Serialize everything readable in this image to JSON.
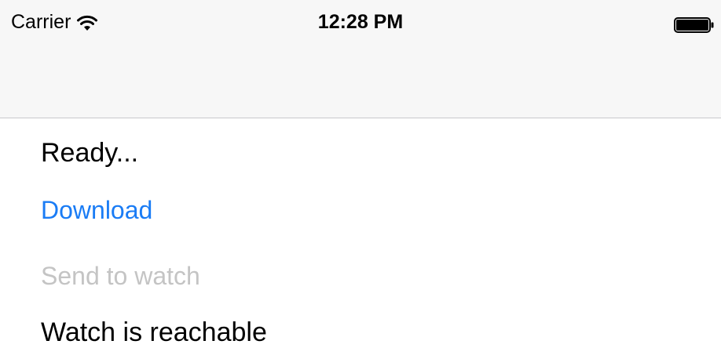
{
  "status_bar": {
    "carrier": "Carrier",
    "time": "12:28 PM",
    "wifi_icon": "wifi-icon",
    "battery_icon": "battery-icon"
  },
  "main": {
    "status_text": "Ready...",
    "download_label": "Download",
    "send_label": "Send to watch",
    "reachability_text": "Watch is reachable"
  },
  "colors": {
    "link_blue": "#1a7cf5",
    "disabled_gray": "#c4c4c4",
    "nav_bar_bg": "#f7f7f7"
  }
}
